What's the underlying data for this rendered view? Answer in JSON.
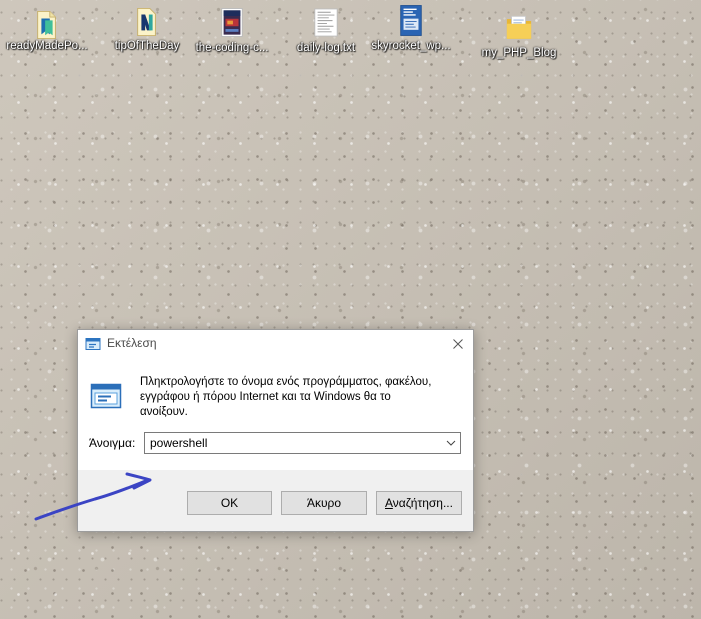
{
  "desktop": {
    "icons": [
      {
        "label": "readyMadePo...",
        "icon": "document-app-icon"
      },
      {
        "label": "tipOfTheDay",
        "icon": "document-app-icon"
      },
      {
        "label": "the-coding-c...",
        "icon": "book-cover-icon"
      },
      {
        "label": "daily-log.txt",
        "icon": "text-file-icon"
      },
      {
        "label": "skyrocket_wp...",
        "icon": "book-cover-icon"
      },
      {
        "label": "my_PHP_Blog",
        "icon": "folder-icon"
      }
    ]
  },
  "run_dialog": {
    "title": "Εκτέλεση",
    "title_icon": "run-icon",
    "close_icon": "close-icon",
    "description_lines": [
      "Πληκτρολογήστε το όνομα ενός προγράμματος, φακέλου,",
      "εγγράφου ή πόρου Internet και τα Windows θα το",
      "ανοίξουν."
    ],
    "open_label": "Άνοιγμα:",
    "input_value": "powershell",
    "dropdown_icon": "chevron-down-icon",
    "buttons": {
      "ok": "OK",
      "cancel": "Άκυρο",
      "browse": "Αναζήτηση..."
    }
  },
  "annotation": {
    "icon": "hand-drawn-arrow-icon"
  },
  "colors": {
    "wallpaper": "#c6bfb4",
    "icon_label_text": "#ffffff",
    "dialog_body": "#ffffff",
    "dialog_footer": "#f0f0f0",
    "button_face": "#e1e1e1",
    "button_border": "#adadad",
    "arrow_annotation": "#3b44c4"
  }
}
